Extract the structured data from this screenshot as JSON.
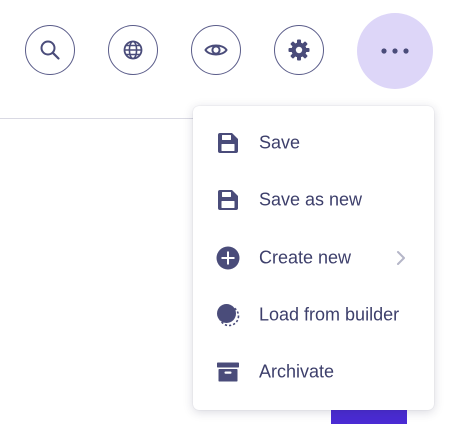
{
  "toolbar": {
    "buttons": [
      {
        "name": "search",
        "icon": "search-icon"
      },
      {
        "name": "globe",
        "icon": "globe-icon"
      },
      {
        "name": "preview",
        "icon": "eye-icon"
      },
      {
        "name": "settings",
        "icon": "gear-icon"
      },
      {
        "name": "more",
        "icon": "more-horizontal-icon"
      }
    ]
  },
  "menu": {
    "items": [
      {
        "label": "Save",
        "icon": "save-icon"
      },
      {
        "label": "Save as new",
        "icon": "save-as-new-icon"
      },
      {
        "label": "Create new",
        "icon": "plus-circle-icon",
        "has_submenu": true
      },
      {
        "label": "Load from builder",
        "icon": "load-builder-icon"
      },
      {
        "label": "Archivate",
        "icon": "archive-icon"
      }
    ]
  },
  "colors": {
    "icon": "#4a4c7a",
    "menu_text": "#3d3f6b",
    "more_button_bg": "#ddd6f8",
    "primary": "#4a2bd3",
    "chevron": "#b5b6c8"
  }
}
